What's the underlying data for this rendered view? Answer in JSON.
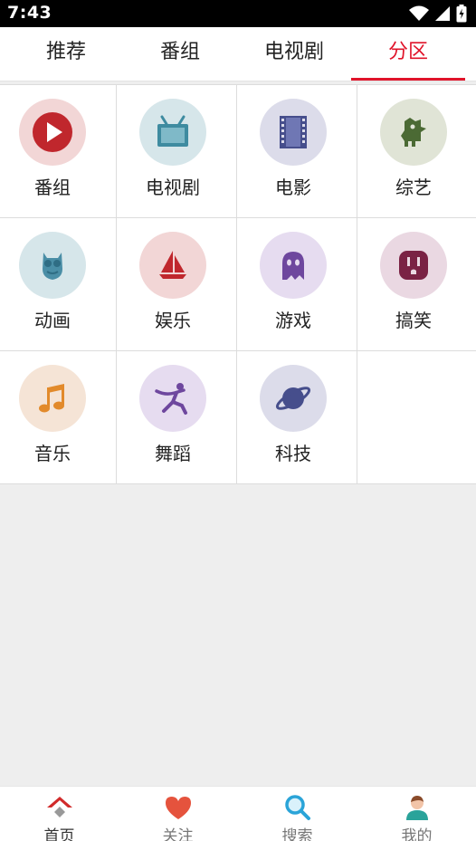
{
  "status_bar": {
    "time": "7:43"
  },
  "tabs": [
    {
      "label": "推荐",
      "active": false
    },
    {
      "label": "番组",
      "active": false
    },
    {
      "label": "电视剧",
      "active": false
    },
    {
      "label": "分区",
      "active": true
    }
  ],
  "categories": [
    {
      "label": "番组",
      "icon": "play-icon",
      "bg": "#f2d6d6"
    },
    {
      "label": "电视剧",
      "icon": "tv-icon",
      "bg": "#d6e6ea"
    },
    {
      "label": "电影",
      "icon": "film-icon",
      "bg": "#dcdcea"
    },
    {
      "label": "综艺",
      "icon": "monster-icon",
      "bg": "#e0e4d6"
    },
    {
      "label": "动画",
      "icon": "owl-icon",
      "bg": "#d6e6ea"
    },
    {
      "label": "娱乐",
      "icon": "sailboat-icon",
      "bg": "#f2d6d6"
    },
    {
      "label": "游戏",
      "icon": "ghost-icon",
      "bg": "#e6dcf0"
    },
    {
      "label": "搞笑",
      "icon": "outlet-icon",
      "bg": "#ead8e2"
    },
    {
      "label": "音乐",
      "icon": "music-note-icon",
      "bg": "#f5e4d6"
    },
    {
      "label": "舞蹈",
      "icon": "dancer-icon",
      "bg": "#e6dcf0"
    },
    {
      "label": "科技",
      "icon": "planet-icon",
      "bg": "#dcdcea"
    }
  ],
  "bottom_nav": [
    {
      "label": "首页",
      "icon": "home-icon",
      "active": true
    },
    {
      "label": "关注",
      "icon": "heart-icon",
      "active": false
    },
    {
      "label": "搜索",
      "icon": "search-icon",
      "active": false
    },
    {
      "label": "我的",
      "icon": "profile-icon",
      "active": false
    }
  ],
  "colors": {
    "accent": "#e0142a"
  }
}
